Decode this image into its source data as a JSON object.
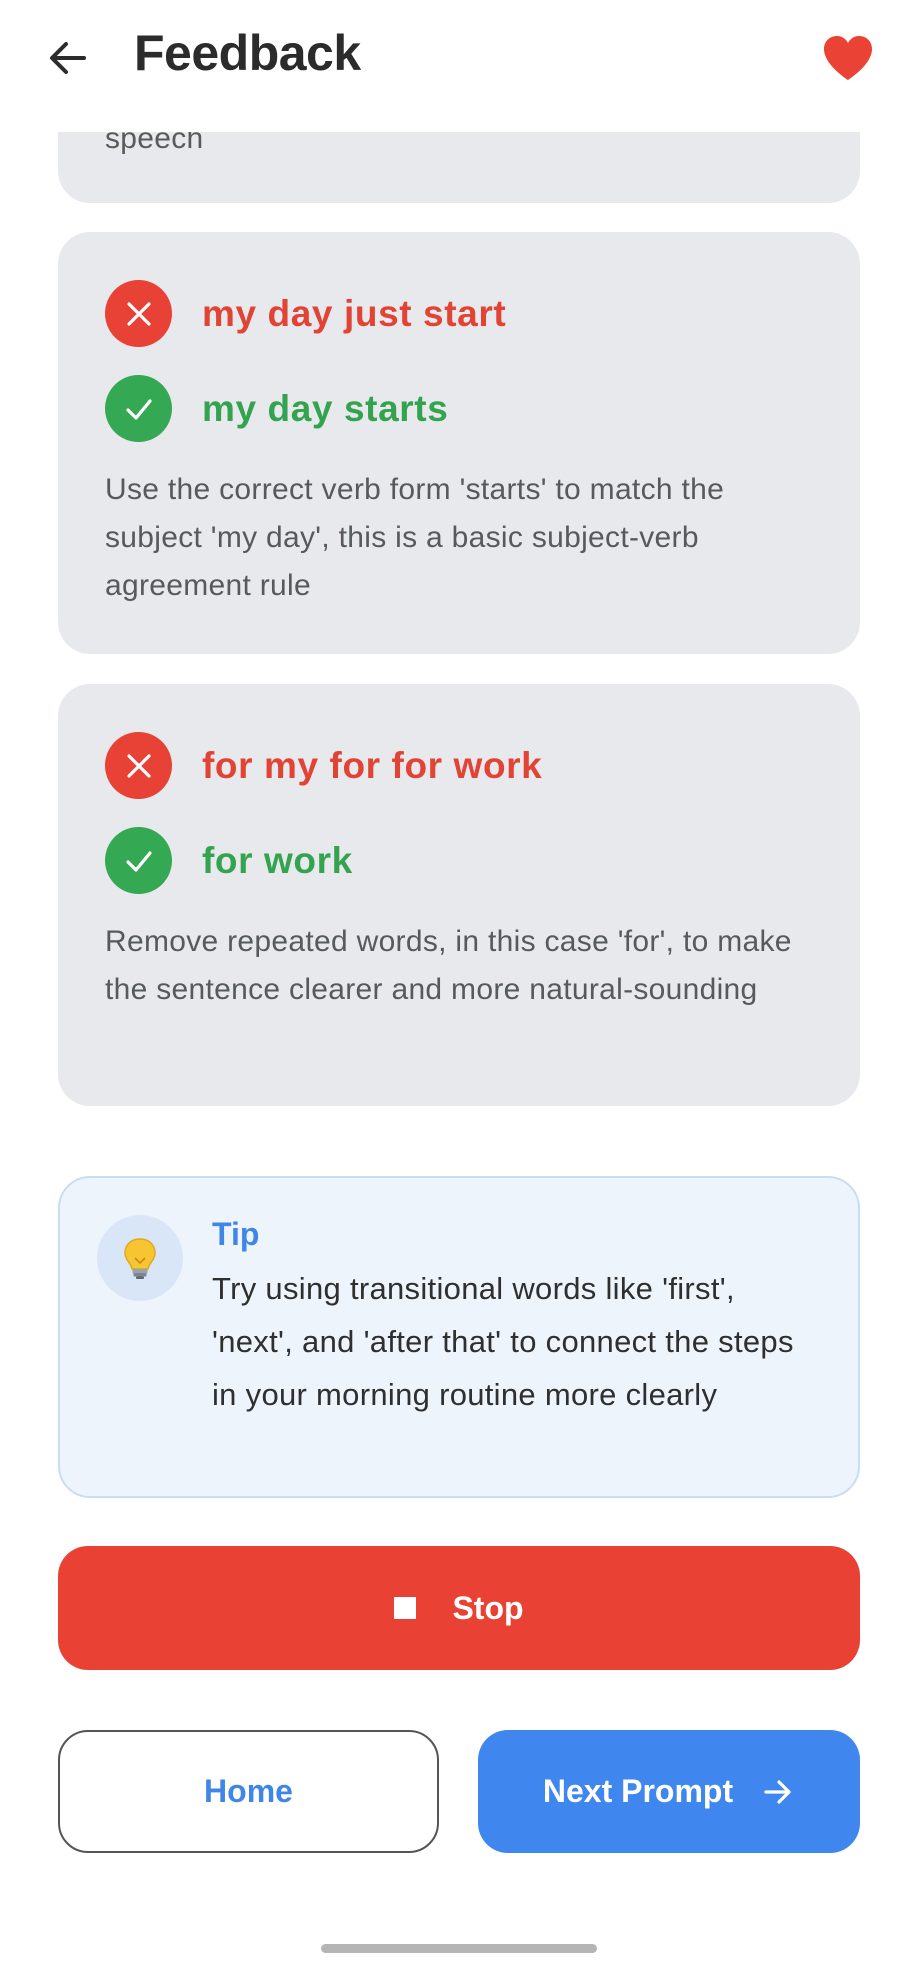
{
  "header": {
    "title": "Feedback",
    "back_icon": "arrow-left-icon",
    "favorite_icon": "heart-icon",
    "favorite_color": "#ea4335"
  },
  "partial_card": {
    "text": "speech"
  },
  "corrections": [
    {
      "wrong": "my day just start",
      "right": "my day starts",
      "explanation": "Use the correct verb form 'starts' to match the subject 'my day', this is a basic subject-verb agreement rule"
    },
    {
      "wrong": "for my for for work",
      "right": "for work",
      "explanation": "Remove repeated words, in this case 'for', to make the sentence clearer and more natural-sounding"
    }
  ],
  "tip": {
    "icon": "lightbulb-icon",
    "title": "Tip",
    "text": "Try using transitional words like 'first', 'next', and 'after that' to connect the steps in your morning routine more clearly"
  },
  "actions": {
    "stop_label": "Stop",
    "home_label": "Home",
    "next_label": "Next Prompt"
  },
  "colors": {
    "wrong": "#e14335",
    "right": "#34a350",
    "accent": "#3f86ef",
    "stop": "#e94234",
    "card_bg": "#e8e9ec"
  }
}
